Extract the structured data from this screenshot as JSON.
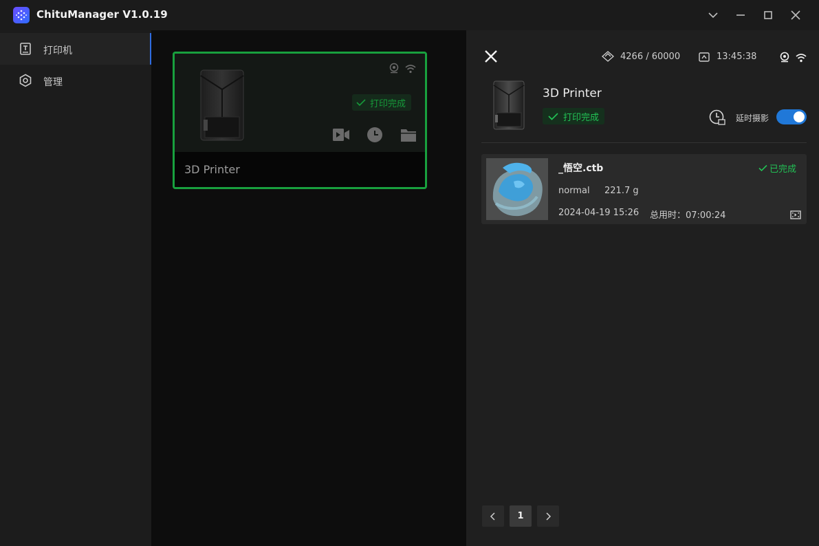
{
  "app": {
    "title": "ChituManager V1.0.19"
  },
  "sidebar": {
    "items": [
      {
        "label": "打印机",
        "icon": "printer-icon",
        "active": true
      },
      {
        "label": "管理",
        "icon": "settings-hex-icon",
        "active": false
      }
    ]
  },
  "printer_card": {
    "name": "3D Printer",
    "status": "打印完成",
    "border_color": "#18a03e",
    "icons": [
      "camera-icon",
      "wifi-icon",
      "video-icon",
      "clock-icon",
      "folder-icon"
    ]
  },
  "detail_panel": {
    "layers": "4266 / 60000",
    "time": "13:45:38",
    "printer_name": "3D Printer",
    "status": "打印完成",
    "timelapse_label": "延时摄影",
    "timelapse_enabled": true
  },
  "job": {
    "file_name": "_悟空.ctb",
    "status": "已完成",
    "mode": "normal",
    "weight": "221.7 g",
    "date": "2024-04-19 15:26",
    "total_time": "总用时：07:00:24"
  },
  "pagination": {
    "current_page": "1"
  },
  "colors": {
    "accent_green": "#22c155",
    "accent_blue": "#2078d8",
    "card_border": "#18a03e"
  }
}
